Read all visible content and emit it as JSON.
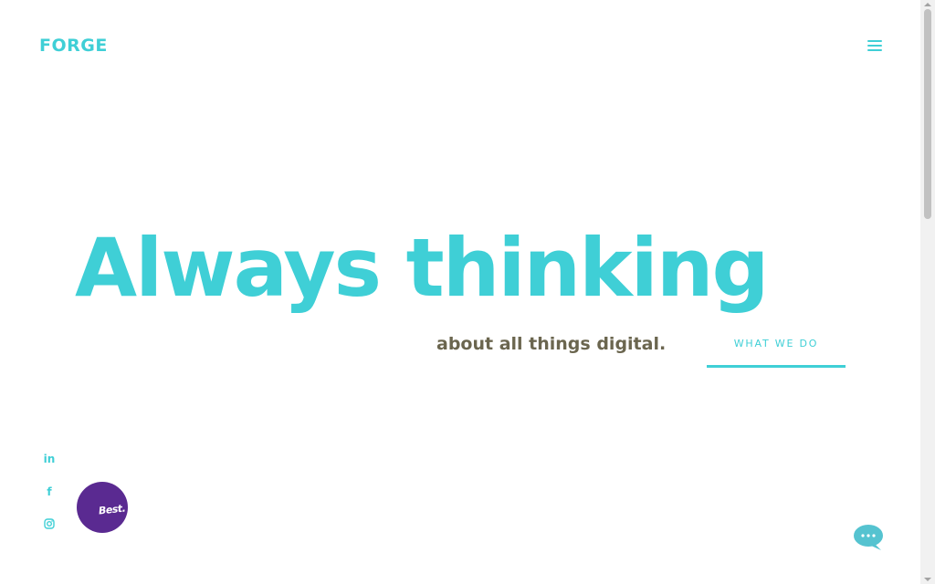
{
  "header": {
    "logo_text": "FORGE",
    "menu_icon": "hamburger-menu-icon"
  },
  "hero": {
    "title": "Always thinking",
    "subtitle": "about all things digital.",
    "cta_label": "WHAT WE DO"
  },
  "social": [
    {
      "name": "linkedin",
      "label": "in",
      "icon": "linkedin-icon"
    },
    {
      "name": "facebook",
      "label": "f",
      "icon": "facebook-icon"
    },
    {
      "name": "instagram",
      "label": "",
      "icon": "instagram-icon"
    }
  ],
  "badge": {
    "text": "Best."
  },
  "chat": {
    "icon": "chat-bubble-icon"
  },
  "colors": {
    "accent": "#3fcfd6",
    "subtitle": "#6b664f",
    "badge": "#5a2a91",
    "chat": "#55c3d0",
    "background": "#ffffff"
  }
}
